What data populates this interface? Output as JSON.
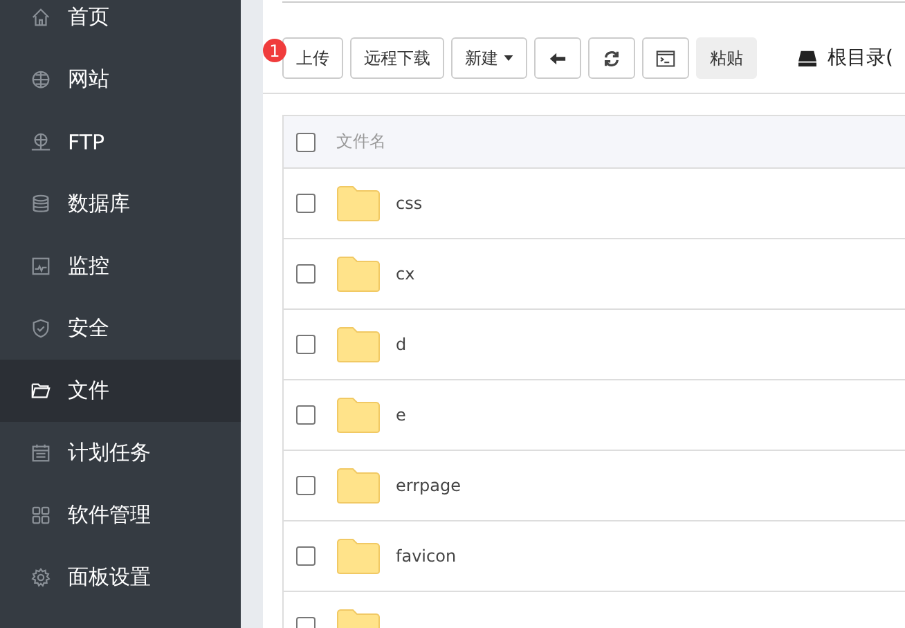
{
  "sidebar": {
    "items": [
      {
        "label": "首页",
        "selected": false
      },
      {
        "label": "网站",
        "selected": false
      },
      {
        "label": "FTP",
        "selected": false
      },
      {
        "label": "数据库",
        "selected": false
      },
      {
        "label": "监控",
        "selected": false
      },
      {
        "label": "安全",
        "selected": false
      },
      {
        "label": "文件",
        "selected": true
      },
      {
        "label": "计划任务",
        "selected": false
      },
      {
        "label": "软件管理",
        "selected": false
      },
      {
        "label": "面板设置",
        "selected": false
      }
    ]
  },
  "toolbar": {
    "badge": "1",
    "buttons": [
      {
        "kind": "text",
        "label": "上传"
      },
      {
        "kind": "text",
        "label": "远程下载"
      },
      {
        "kind": "dropdown",
        "label": "新建"
      },
      {
        "kind": "back"
      },
      {
        "kind": "refresh"
      },
      {
        "kind": "terminal"
      },
      {
        "kind": "paste",
        "label": "粘贴"
      }
    ],
    "path": "根目录("
  },
  "table": {
    "header": {
      "label": "文件名",
      "checked": false
    },
    "rows": [
      {
        "name": "css",
        "checked": false
      },
      {
        "name": "cx",
        "checked": false
      },
      {
        "name": "d",
        "checked": false
      },
      {
        "name": "e",
        "checked": false
      },
      {
        "name": "errpage",
        "checked": false
      },
      {
        "name": "favicon",
        "checked": false
      },
      {
        "checked": false
      }
    ]
  }
}
